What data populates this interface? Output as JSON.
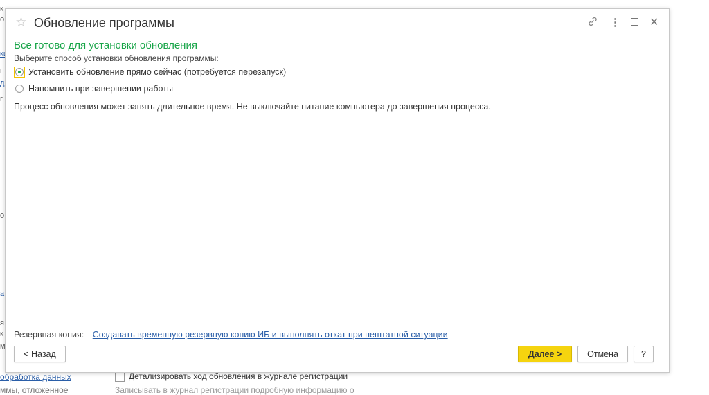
{
  "background": {
    "left_fragments": [
      "к",
      "о",
      "ки",
      "г",
      "д",
      "г",
      "о",
      "а",
      "я",
      "к",
      "м"
    ],
    "bottom_link": "обработка данных",
    "bottom_sub": "ммы, отложенное",
    "bottom_checkbox_label": "Детализировать ход обновления в журнале регистрации",
    "bottom_checkbox_sub": "Записывать в журнал регистрации подробную информацию о"
  },
  "dialog": {
    "title": "Обновление программы",
    "icons": {
      "favorite": "star-icon",
      "link": "link-icon",
      "menu": "more-vertical-icon",
      "maximize": "maximize-icon",
      "close": "close-icon"
    },
    "heading": "Все готово для установки обновления",
    "prompt": "Выберите способ установки обновления программы:",
    "options": [
      {
        "label": "Установить обновление прямо сейчас (потребуется перезапуск)",
        "selected": true
      },
      {
        "label": "Напомнить при завершении работы",
        "selected": false
      }
    ],
    "info": "Процесс обновления может занять длительное время. Не выключайте питание компьютера до завершения процесса.",
    "backup_label": "Резервная копия:",
    "backup_link": "Создавать временную резервную копию ИБ и выполнять откат при нештатной ситуации",
    "buttons": {
      "back": "< Назад",
      "next": "Далее >",
      "cancel": "Отмена",
      "help": "?"
    },
    "colors": {
      "accent_green": "#18a548",
      "primary_button": "#f5d40f",
      "link": "#2a5ea8"
    }
  }
}
